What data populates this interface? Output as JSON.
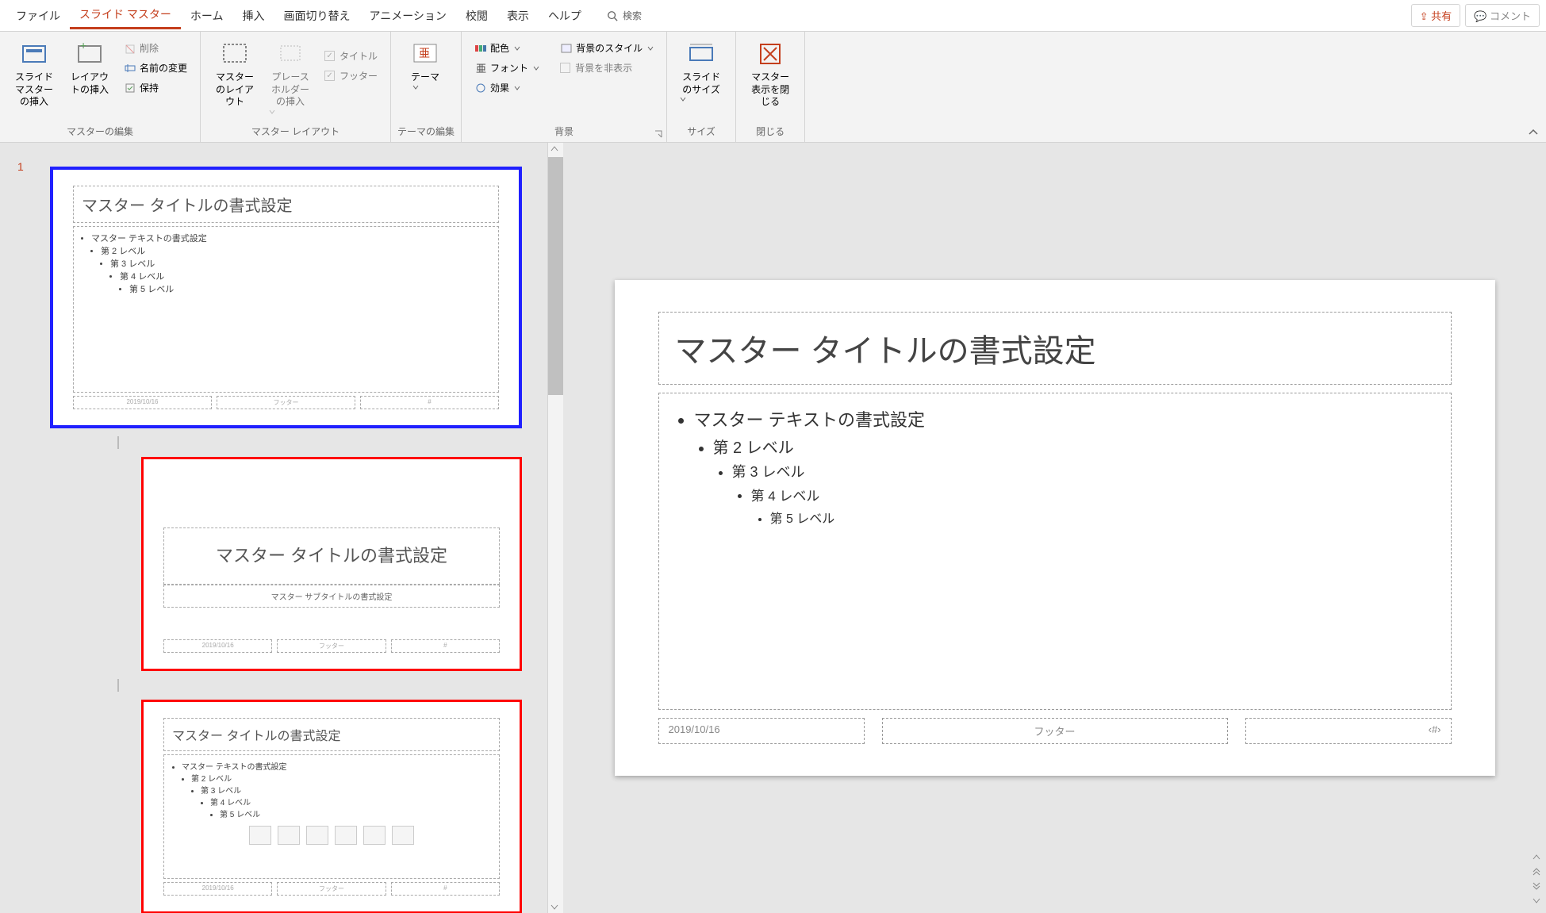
{
  "menu": {
    "tabs": [
      "ファイル",
      "スライド マスター",
      "ホーム",
      "挿入",
      "画面切り替え",
      "アニメーション",
      "校閲",
      "表示",
      "ヘルプ"
    ],
    "active_index": 1,
    "search_label": "検索",
    "share_label": "共有",
    "comment_label": "コメント"
  },
  "ribbon": {
    "groups": {
      "edit_master": {
        "label": "マスターの編集",
        "insert_master": "スライド マスターの挿入",
        "insert_layout": "レイアウトの挿入",
        "delete": "削除",
        "rename": "名前の変更",
        "preserve": "保持"
      },
      "master_layout": {
        "label": "マスター レイアウト",
        "master_layout_btn": "マスターのレイアウト",
        "insert_ph": "プレースホルダーの挿入",
        "chk_title": "タイトル",
        "chk_footer": "フッター"
      },
      "edit_theme": {
        "label": "テーマの編集",
        "theme_btn": "テーマ"
      },
      "background": {
        "label": "背景",
        "colors": "配色",
        "fonts": "フォント",
        "effects": "効果",
        "bg_styles": "背景のスタイル",
        "hide_bg": "背景を非表示"
      },
      "size": {
        "label": "サイズ",
        "btn": "スライドのサイズ"
      },
      "close": {
        "label": "閉じる",
        "btn": "マスター表示を閉じる"
      }
    }
  },
  "thumbnails": {
    "master_num": "1",
    "master": {
      "title": "マスター タイトルの書式設定",
      "text": "マスター テキストの書式設定",
      "l2": "第 2 レベル",
      "l3": "第 3 レベル",
      "l4": "第 4 レベル",
      "l5": "第 5 レベル",
      "date": "2019/10/16",
      "footer": "フッター",
      "num": "#"
    },
    "layout1": {
      "title": "マスター タイトルの書式設定",
      "subtitle": "マスター サブタイトルの書式設定",
      "date": "2019/10/16",
      "footer": "フッター",
      "num": "#"
    },
    "layout2": {
      "title": "マスター タイトルの書式設定",
      "text": "マスター テキストの書式設定",
      "l2": "第 2 レベル",
      "l3": "第 3 レベル",
      "l4": "第 4 レベル",
      "l5": "第 5 レベル",
      "date": "2019/10/16",
      "footer": "フッター",
      "num": "#"
    }
  },
  "editor": {
    "title": "マスター タイトルの書式設定",
    "body_text": "マスター テキストの書式設定",
    "l2": "第 2 レベル",
    "l3": "第 3 レベル",
    "l4": "第 4 レベル",
    "l5": "第 5 レベル",
    "footer_date": "2019/10/16",
    "footer_center": "フッター",
    "footer_num": "‹#›"
  }
}
